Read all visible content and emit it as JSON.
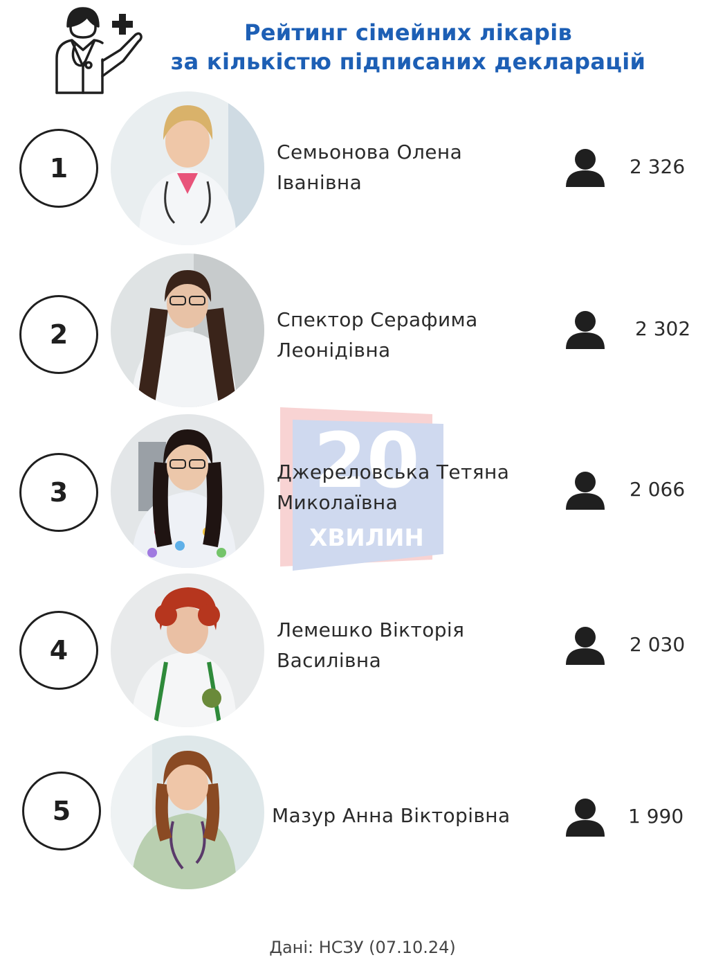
{
  "header": {
    "title_line1": "Рейтинг сімейних лікарів",
    "title_line2": "за кількістю підписаних декларацій",
    "icon": "doctor-icon"
  },
  "watermark": {
    "number": "20",
    "text": "ХВИЛИН"
  },
  "doctors": [
    {
      "rank": "1",
      "name_line1": "Семьонова Олена",
      "name_line2": "Іванівна",
      "count": "2 326",
      "bg": "#e9eef0",
      "coat": "#f4f6f8",
      "hair": "#d9b26a"
    },
    {
      "rank": "2",
      "name_line1": "Спектор Серафима",
      "name_line2": "Леонідівна",
      "count": "2 302",
      "bg": "#dfe3e4",
      "coat": "#f2f4f6",
      "hair": "#3a241a"
    },
    {
      "rank": "3",
      "name_line1": "Джереловська Тетяна",
      "name_line2": "Миколаївна",
      "count": "2 066",
      "bg": "#e3e6e8",
      "coat": "#eef1f6",
      "hair": "#1f1412"
    },
    {
      "rank": "4",
      "name_line1": "Лемешко Вікторія",
      "name_line2": "Василівна",
      "count": "2 030",
      "bg": "#e8eaeb",
      "coat": "#f5f6f7",
      "hair": "#b6361e"
    },
    {
      "rank": "5",
      "name_line1": "Мазур Анна Вікторівна",
      "name_line2": "",
      "count": "1 990",
      "bg": "#dfe8ea",
      "coat": "#b9cfb0",
      "hair": "#8a4a23"
    }
  ],
  "source": "Дані: НСЗУ (07.10.24)",
  "colors": {
    "title": "#1d5fb5",
    "text": "#2a2a2a"
  }
}
